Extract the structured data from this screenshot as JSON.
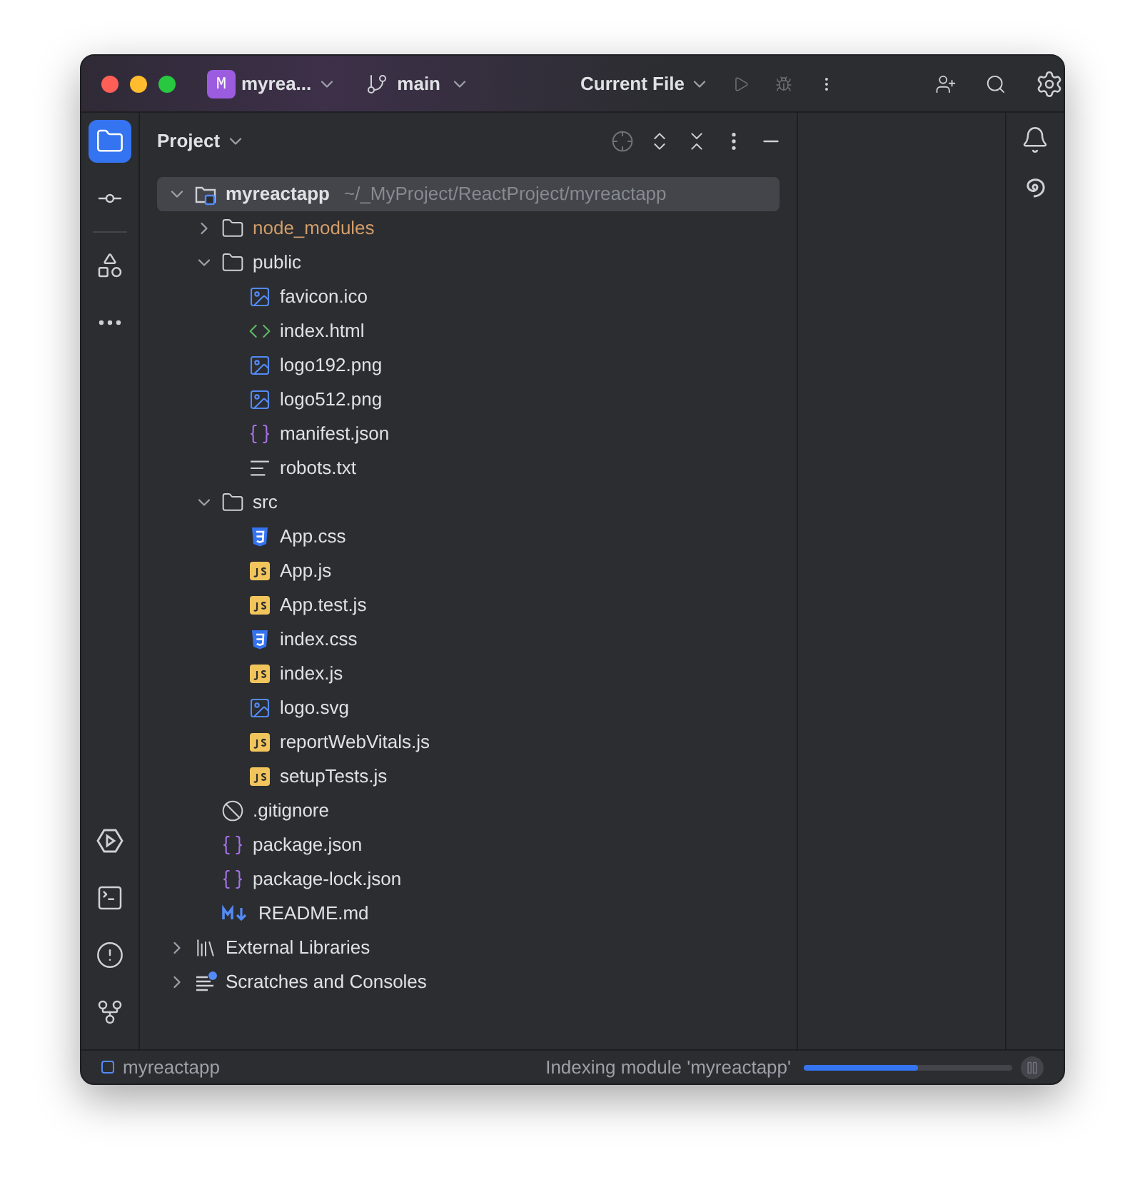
{
  "window": {
    "project_badge": "M",
    "project_name": "myrea...",
    "branch": "main",
    "run_config": "Current File"
  },
  "left_toolbar": [
    {
      "kind": "project",
      "selected": true
    },
    {
      "kind": "commit",
      "selected": false
    },
    {
      "kind": "structure",
      "selected": false
    },
    {
      "kind": "more",
      "selected": false
    }
  ],
  "project_panel": {
    "title": "Project"
  },
  "tree": [
    {
      "kind": "project",
      "name": "myreactapp",
      "path": "~/_MyProject/ReactProject/myreactapp",
      "selected": true,
      "expanded": true,
      "excluded": false,
      "children": [
        {
          "kind": "folder",
          "name": "node_modules",
          "selected": false,
          "expanded": false,
          "excluded": true
        },
        {
          "kind": "folder",
          "name": "public",
          "selected": false,
          "expanded": true,
          "excluded": false,
          "children": [
            {
              "kind": "image",
              "name": "favicon.ico",
              "selected": false,
              "excluded": false
            },
            {
              "kind": "html",
              "name": "index.html",
              "selected": false,
              "excluded": false
            },
            {
              "kind": "image",
              "name": "logo192.png",
              "selected": false,
              "excluded": false
            },
            {
              "kind": "image",
              "name": "logo512.png",
              "selected": false,
              "excluded": false
            },
            {
              "kind": "json",
              "name": "manifest.json",
              "selected": false,
              "excluded": false
            },
            {
              "kind": "text",
              "name": "robots.txt",
              "selected": false,
              "excluded": false
            }
          ]
        },
        {
          "kind": "folder",
          "name": "src",
          "selected": false,
          "expanded": true,
          "excluded": false,
          "children": [
            {
              "kind": "css",
              "name": "App.css",
              "selected": false,
              "excluded": false
            },
            {
              "kind": "js",
              "name": "App.js",
              "selected": false,
              "excluded": false
            },
            {
              "kind": "js",
              "name": "App.test.js",
              "selected": false,
              "excluded": false
            },
            {
              "kind": "css",
              "name": "index.css",
              "selected": false,
              "excluded": false
            },
            {
              "kind": "js",
              "name": "index.js",
              "selected": false,
              "excluded": false
            },
            {
              "kind": "image",
              "name": "logo.svg",
              "selected": false,
              "excluded": false
            },
            {
              "kind": "js",
              "name": "reportWebVitals.js",
              "selected": false,
              "excluded": false
            },
            {
              "kind": "js",
              "name": "setupTests.js",
              "selected": false,
              "excluded": false
            }
          ]
        },
        {
          "kind": "ignore",
          "name": ".gitignore",
          "selected": false,
          "excluded": false
        },
        {
          "kind": "json",
          "name": "package.json",
          "selected": false,
          "excluded": false
        },
        {
          "kind": "json",
          "name": "package-lock.json",
          "selected": false,
          "excluded": false
        },
        {
          "kind": "markdown",
          "name": "README.md",
          "selected": false,
          "excluded": false
        }
      ]
    },
    {
      "kind": "library",
      "name": "External Libraries",
      "selected": false,
      "expanded": false,
      "excluded": false
    },
    {
      "kind": "scratches",
      "name": "Scratches and Consoles",
      "selected": false,
      "expanded": false,
      "excluded": false
    }
  ],
  "status_bar": {
    "breadcrumb": "myreactapp",
    "task": "Indexing module 'myreactapp'",
    "level": 0.55
  }
}
